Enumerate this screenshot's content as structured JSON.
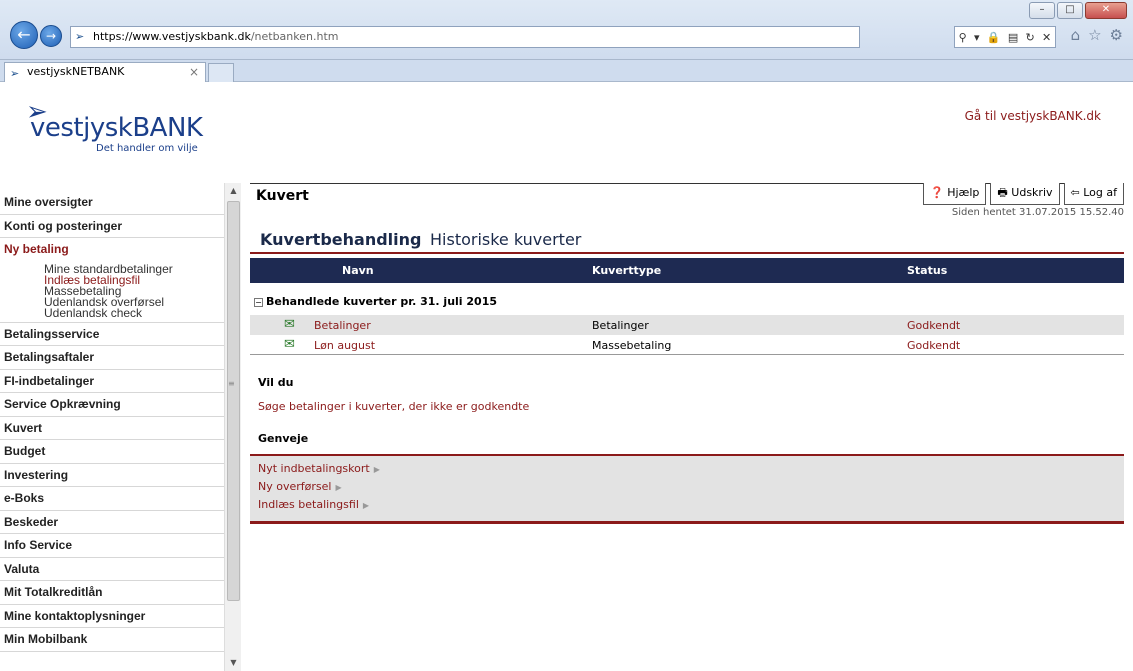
{
  "browser": {
    "url_host": "https://www.vestjyskbank.dk",
    "url_path": "/netbanken.htm",
    "tab_title": "vestjyskNETBANK",
    "win_min": "–",
    "win_max": "□",
    "win_close": "✕"
  },
  "header": {
    "logo_text": "vestjyskBANK",
    "tagline": "Det handler om vilje",
    "goto_link": "Gå til vestjyskBANK.dk"
  },
  "sidebar": {
    "items_top": [
      "Mine oversigter",
      "Konti og posteringer"
    ],
    "active_item": "Ny betaling",
    "sub_items": [
      "Mine standardbetalinger",
      "Indlæs betalingsfil",
      "Massebetaling",
      "Udenlandsk overførsel",
      "Udenlandsk check"
    ],
    "active_sub_index": 1,
    "items_bottom": [
      "Betalingsservice",
      "Betalingsaftaler",
      "FI-indbetalinger",
      "Service Opkrævning",
      "Kuvert",
      "Budget",
      "Investering",
      "e-Boks",
      "Beskeder",
      "Info Service",
      "Valuta",
      "Mit Totalkreditlån",
      "Mine kontaktoplysninger",
      "Min Mobilbank"
    ]
  },
  "content": {
    "title": "Kuvert",
    "help": "Hjælp",
    "print": "Udskriv",
    "logout": "Log af",
    "fetched": "Siden hentet 31.07.2015 15.52.40",
    "tab_active": "Kuvertbehandling",
    "tab_other": "Historiske kuverter",
    "columns": {
      "name": "Navn",
      "type": "Kuverttype",
      "status": "Status"
    },
    "group_title": "Behandlede kuverter pr. 31. juli 2015",
    "rows": [
      {
        "name": "Betalinger",
        "type": "Betalinger",
        "status": "Godkendt"
      },
      {
        "name": "Løn august",
        "type": "Massebetaling",
        "status": "Godkendt"
      }
    ],
    "vildu_heading": "Vil du",
    "search_link": "Søge betalinger i kuverter, der ikke er godkendte",
    "shortcuts_heading": "Genveje",
    "shortcuts": [
      "Nyt indbetalingskort",
      "Ny overførsel",
      "Indlæs betalingsfil"
    ]
  },
  "colors": {
    "accent": "#8b1a1a",
    "header_bar": "#1e2a52",
    "brand": "#1b3f8a"
  }
}
